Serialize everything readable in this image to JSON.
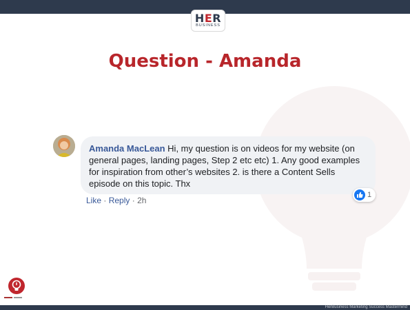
{
  "header": {
    "logo_main": "HER",
    "logo_sub": "BUSINESS"
  },
  "slide": {
    "title": "Question - Amanda"
  },
  "comment": {
    "author": "Amanda MacLean",
    "text": "Hi, my question is on videos for my website (on general pages, landing pages, Step 2 etc etc) 1. Any good examples for inspiration from other’s websites 2. is there a Content Sells episode on this topic. Thx",
    "reactions": {
      "icon": "thumbs-up-icon",
      "count": "1"
    },
    "actions": {
      "like": "Like",
      "reply": "Reply",
      "separator": "·",
      "time": "2h"
    }
  },
  "footer": {
    "text": "HerBusiness Marketing Success Mastermind"
  },
  "colors": {
    "navy": "#2e3a4d",
    "brand_red": "#b8262b",
    "fb_blue": "#1877f2",
    "author_blue": "#385898"
  }
}
